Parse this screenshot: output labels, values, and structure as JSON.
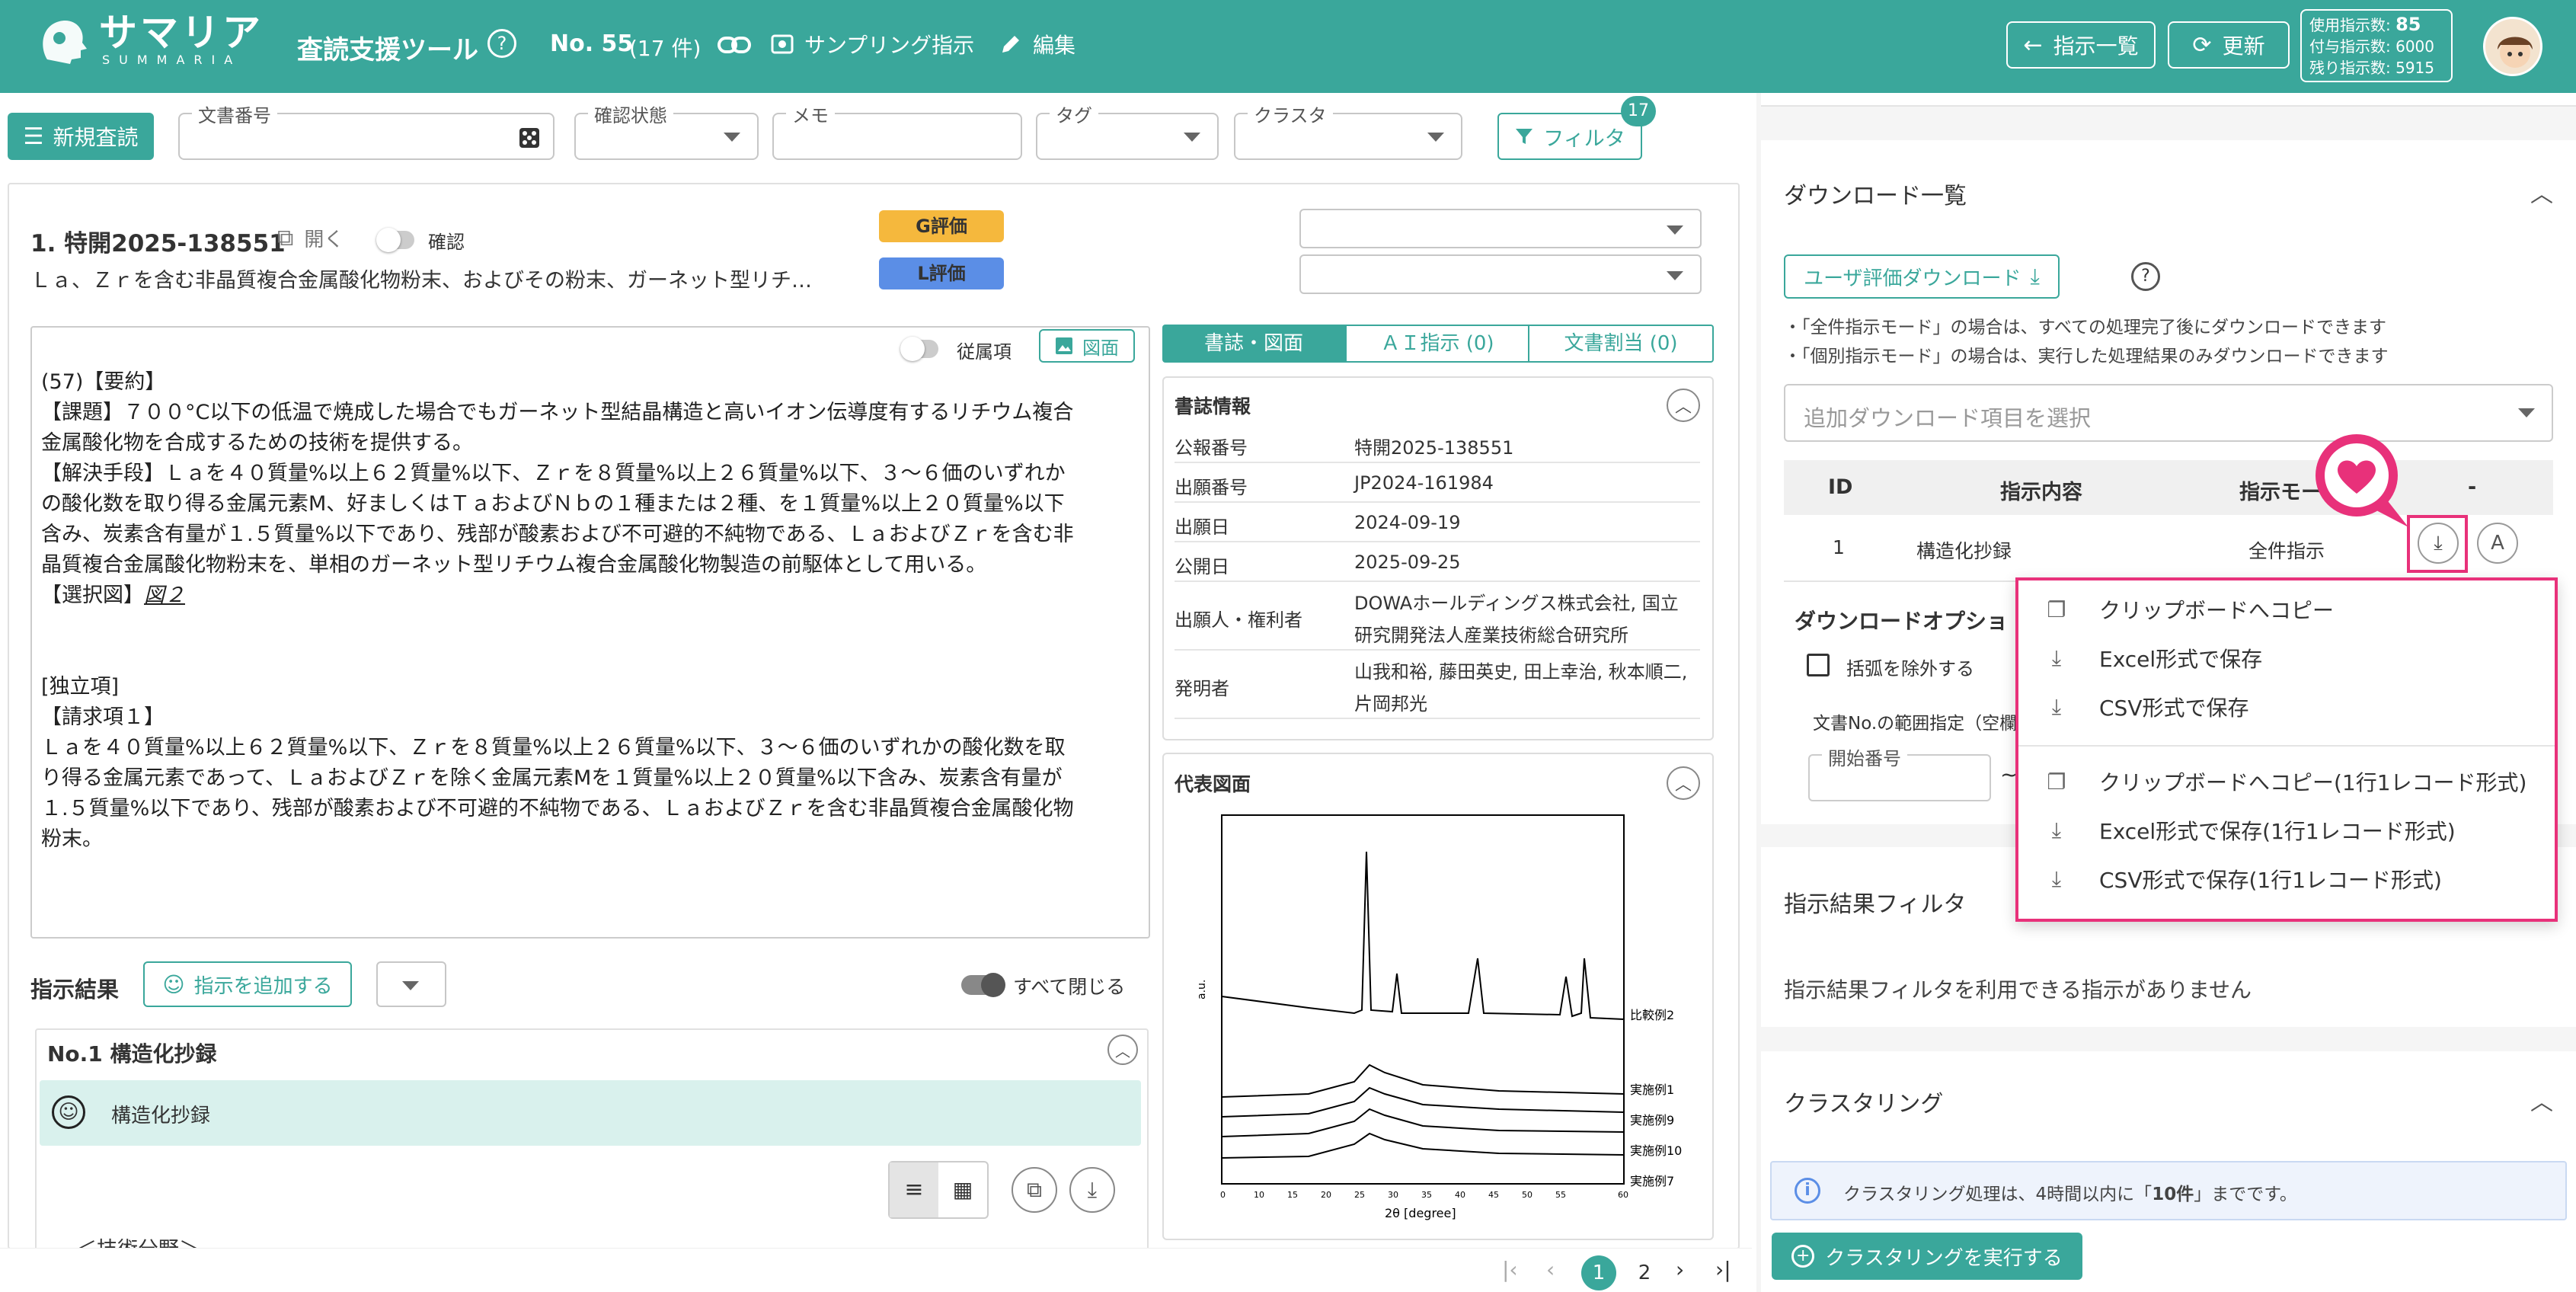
{
  "header": {
    "logo_main": "サマリア",
    "logo_sub": "SUMMARIA",
    "title": "査読支援ツール",
    "doc_no": "No. 55",
    "doc_count": "(17 件)",
    "sampling_label": "サンプリング指示",
    "edit_label": "編集",
    "list_btn": "指示一覧",
    "refresh_btn": "更新",
    "usage_label": "使用指示数:",
    "usage_value": "85",
    "granted": "付与指示数: 6000",
    "remaining": "残り指示数: 5915"
  },
  "toolbar": {
    "new_review": "新規査読",
    "doc_no_label": "文書番号",
    "confirm_label": "確認状態",
    "memo_label": "メモ",
    "tag_label": "タグ",
    "cluster_label": "クラスタ",
    "filter_label": "フィルタ",
    "filter_badge": "17"
  },
  "document": {
    "title": "1. 特開2025-138551",
    "open_label": "開く",
    "confirm_label": "確認",
    "g_badge": "G評価",
    "l_badge": "L評価",
    "subtitle": "Ｌａ、Ｚｒを含む非晶質複合金属酸化物粉末、およびその粉末、ガーネット型リチ…",
    "dependent_label": "従属項",
    "figure_btn": "図面",
    "body_lines": [
      "(57)【要約】",
      "【課題】７００°C以下の低温で焼成した場合でもガーネット型結晶構造と高いイオン伝導度有するリチウム複合",
      "金属酸化物を合成するための技術を提供する。",
      "【解決手段】Ｌａを４０質量%以上６２質量%以下、Ｚｒを８質量%以上２６質量%以下、３～６価のいずれか",
      "の酸化数を取り得る金属元素M、好ましくはＴａおよびＮｂの１種または２種、を１質量%以上２０質量%以下",
      "含み、炭素含有量が１.５質量%以下であり、残部が酸素および不可避的不純物である、ＬａおよびＺｒを含む非",
      "晶質複合金属酸化物粉末を、単相のガーネット型リチウム複合金属酸化物製造の前駆体として用いる。"
    ],
    "selected_fig_prefix": "【選択図】",
    "selected_fig": "図２",
    "indep_title": "[独立項]",
    "claim_title": "【請求項１】",
    "claim_lines": [
      "Ｌａを４０質量%以上６２質量%以下、Ｚｒを８質量%以上２６質量%以下、３～６価のいずれかの酸化数を取",
      "り得る金属元素であって、ＬａおよびＺｒを除く金属元素Mを１質量%以上２０質量%以下含み、炭素含有量が",
      "１.５質量%以下であり、残部が酸素および不可避的不純物である、ＬａおよびＺｒを含む非晶質複合金属酸化物",
      "粉末。"
    ]
  },
  "tabs": [
    "書誌・図面",
    "ＡＩ指示 (0)",
    "文書割当 (0)"
  ],
  "biblio": {
    "title": "書誌情報",
    "rows": [
      {
        "k": "公報番号",
        "v": "特開2025-138551"
      },
      {
        "k": "出願番号",
        "v": "JP2024-161984"
      },
      {
        "k": "出願日",
        "v": "2024-09-19"
      },
      {
        "k": "公開日",
        "v": "2025-09-25"
      },
      {
        "k": "出願人・権利者",
        "v": "DOWAホールディングス株式会社, 国立",
        "v2": "研究開発法人産業技術総合研究所"
      },
      {
        "k": "発明者",
        "v": "山我和裕, 藤田英史, 田上幸治, 秋本順二,",
        "v2": "片岡邦光"
      }
    ]
  },
  "figure": {
    "title": "代表図面",
    "labels": [
      "比較例2",
      "実施例1",
      "実施例9",
      "実施例10",
      "実施例7"
    ],
    "xlabel": "2θ [degree]",
    "ylabel": "a.u.",
    "xticks": [
      "0",
      "10",
      "15",
      "20",
      "25",
      "30",
      "35",
      "40",
      "45",
      "50",
      "55",
      "60"
    ]
  },
  "results": {
    "title": "指示結果",
    "add_btn": "指示を追加する",
    "close_all": "すべて閉じる",
    "item_title": "No.1 構造化抄録",
    "item_name": "構造化抄録",
    "partial_text": "＜技術分野＞"
  },
  "pagination": {
    "pages": [
      "1",
      "2"
    ]
  },
  "right": {
    "download_title": "ダウンロード一覧",
    "user_eval_btn": "ユーザ評価ダウンロード",
    "note1": "・「全件指示モード」の場合は、すべての処理完了後にダウンロードできます",
    "note2": "・「個別指示モード」の場合は、実行した処理結果のみダウンロードできます",
    "select_placeholder": "追加ダウンロード項目を選択",
    "table_headers": [
      "ID",
      "指示内容",
      "指示モー",
      "-"
    ],
    "table_row": {
      "id": "1",
      "content": "構造化抄録",
      "mode": "全件指示"
    },
    "options_title": "ダウンロードオプショ",
    "exclude_brackets": "括弧を除外する",
    "range_label": "文書No.の範囲指定（空欄",
    "start_label": "開始番号",
    "filter_title": "指示結果フィルタ",
    "filter_empty": "指示結果フィルタを利用できる指示がありません",
    "cluster_title": "クラスタリング",
    "cluster_info_prefix": "クラスタリング処理は、4時間以内に「",
    "cluster_info_bold": "10件",
    "cluster_info_suffix": "」までです。",
    "cluster_btn": "クラスタリングを実行する"
  },
  "menu": {
    "items": [
      "クリップボードへコピー",
      "Excel形式で保存",
      "CSV形式で保存",
      "クリップボードへコピー(1行1レコード形式)",
      "Excel形式で保存(1行1レコード形式)",
      "CSV形式で保存(1行1レコード形式)"
    ]
  },
  "colors": {
    "primary": "#3aa79b",
    "highlight": "#e8317a",
    "g_badge": "#f5b83d",
    "l_badge": "#5b8ee6"
  }
}
